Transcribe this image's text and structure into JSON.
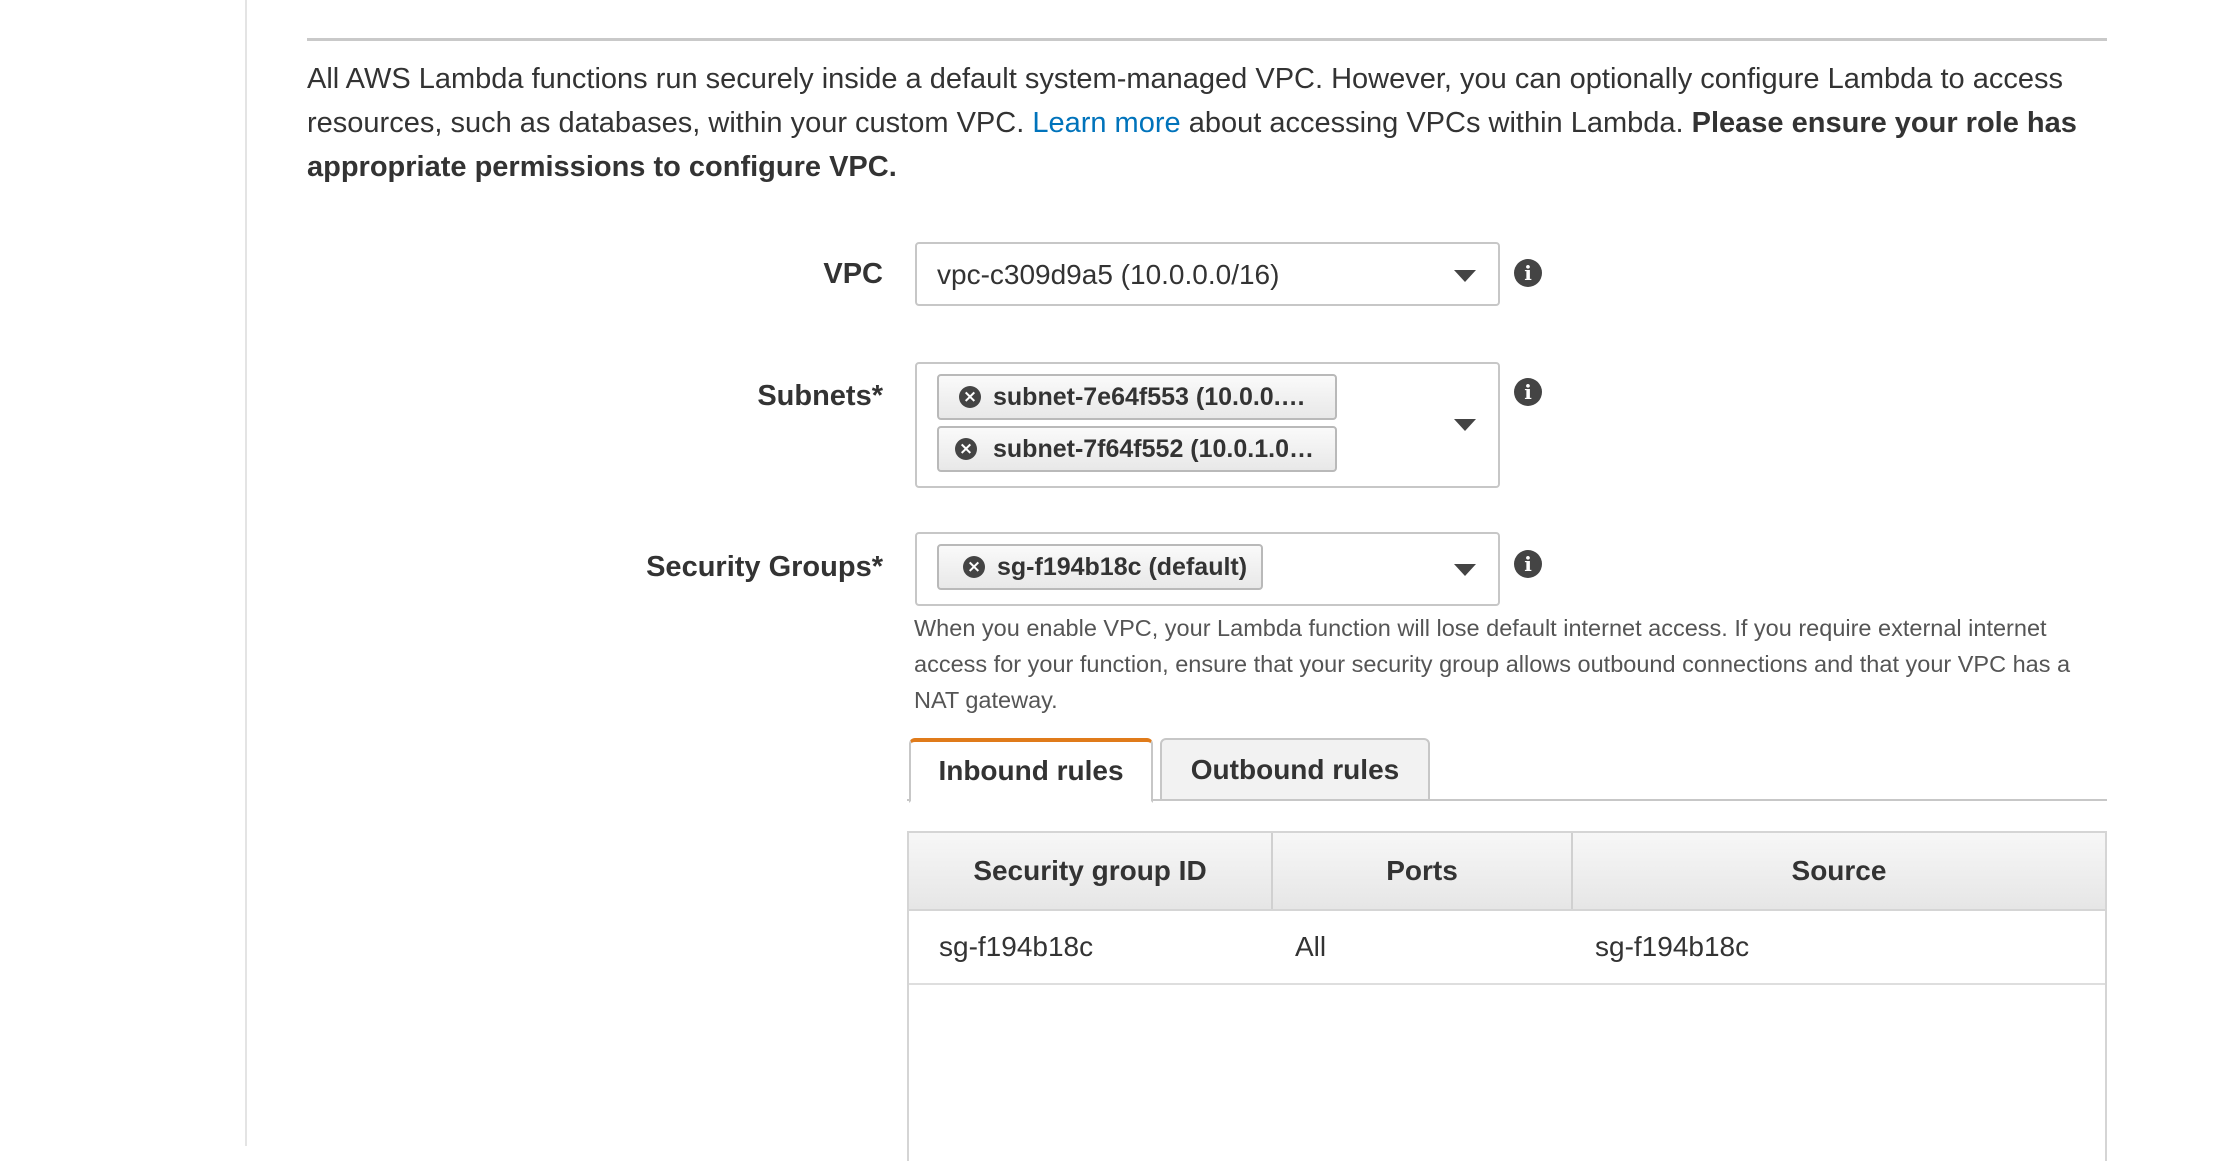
{
  "intro": {
    "text_before_link": "All AWS Lambda functions run securely inside a default system-managed VPC. However, you can optionally configure Lambda to access resources, such as databases, within your custom VPC. ",
    "link_text": "Learn more",
    "text_after_link": " about accessing VPCs within Lambda. ",
    "bold_text": "Please ensure your role has appropriate permissions to configure VPC."
  },
  "vpc": {
    "label": "VPC",
    "value": "vpc-c309d9a5 (10.0.0.0/16)"
  },
  "subnets": {
    "label": "Subnets*",
    "tokens": [
      "subnet-7e64f553 (10.0.0.…",
      "subnet-7f64f552 (10.0.1.0…"
    ]
  },
  "security_groups": {
    "label": "Security Groups*",
    "tokens": [
      "sg-f194b18c (default)"
    ],
    "help_text": "When you enable VPC, your Lambda function will lose default internet access. If you require external internet access for your function, ensure that your security group allows outbound connections and that your VPC has a NAT gateway."
  },
  "tabs": [
    {
      "label": "Inbound rules",
      "active": true
    },
    {
      "label": "Outbound rules",
      "active": false
    }
  ],
  "rules_table": {
    "columns": [
      "Security group ID",
      "Ports",
      "Source"
    ],
    "rows": [
      [
        "sg-f194b18c",
        "All",
        "sg-f194b18c"
      ]
    ]
  },
  "icons": {
    "info": "info-icon",
    "remove": "remove-token-icon",
    "dropdown": "chevron-down-icon"
  },
  "colors": {
    "link": "#0073bb",
    "active_tab_accent": "#e07b1a"
  }
}
